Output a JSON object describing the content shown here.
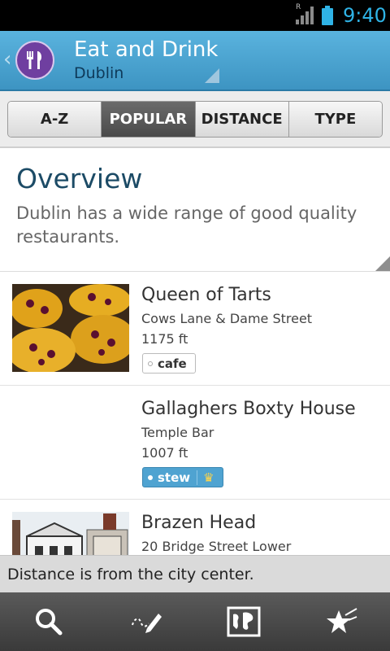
{
  "status_bar": {
    "time": "9:40",
    "network_label": "R"
  },
  "header": {
    "title": "Eat and Drink",
    "subtitle": "Dublin",
    "back_icon": "chevron-left-icon",
    "app_icon": "fork-knife-icon"
  },
  "tabs": [
    {
      "label": "A-Z",
      "active": false
    },
    {
      "label": "POPULAR",
      "active": true
    },
    {
      "label": "DISTANCE",
      "active": false
    },
    {
      "label": "TYPE",
      "active": false
    }
  ],
  "overview": {
    "title": "Overview",
    "text": "Dublin has a wide range of good quality restaurants."
  },
  "places": [
    {
      "name": "Queen of Tarts",
      "address": "Cows Lane & Dame Street",
      "distance": "1175 ft",
      "tag": "cafe",
      "premium": false
    },
    {
      "name": "Gallaghers Boxty House",
      "address": "Temple Bar",
      "distance": "1007 ft",
      "tag": "stew",
      "premium": true
    },
    {
      "name": "Brazen Head",
      "address": "20 Bridge Street Lower",
      "distance": "",
      "tag": "",
      "premium": false
    }
  ],
  "footer_note": "Distance is from the city center.",
  "bottom_bar": [
    {
      "icon": "search-icon"
    },
    {
      "icon": "pen-icon"
    },
    {
      "icon": "map-icon"
    },
    {
      "icon": "star-icon"
    }
  ],
  "colors": {
    "header": "#4aa3d0",
    "accent": "#2fb3e6",
    "app_icon": "#6f3fa0",
    "premium_tag": "#4fa3d1"
  }
}
